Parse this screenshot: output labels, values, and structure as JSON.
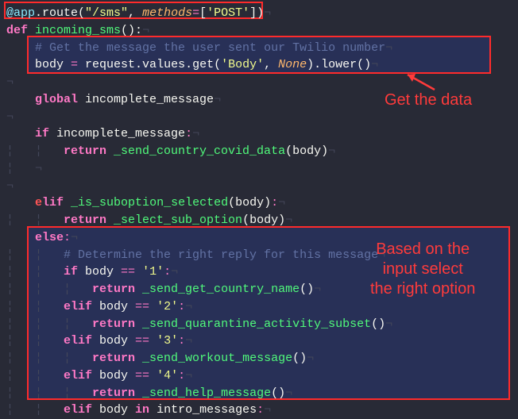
{
  "annotations": {
    "get_data": "Get the data",
    "select_option": "Based on the\ninput select\nthe right option"
  },
  "code": {
    "l1_decorator": "@app",
    "l1_route": ".route(",
    "l1_path": "\"/sms\"",
    "l1_comma": ", ",
    "l1_methods_kw": "methods",
    "l1_eq": "=",
    "l1_br_open": "[",
    "l1_methods_val": "'POST'",
    "l1_br_close": "])",
    "l2_def": "def ",
    "l2_fn": "incoming_sms",
    "l2_sig": "():",
    "l3_cmt": "# Get the message the user sent our Twilio number",
    "l4_body": "body ",
    "l4_eq": "=",
    "l4_req": " request.values.get(",
    "l4_key": "'Body'",
    "l4_c": ", ",
    "l4_none": "None",
    "l4_tail": ").lower()",
    "l6_global": "global ",
    "l6_var": "incomplete_message",
    "l8_if": "if ",
    "l8_var": "incomplete_message",
    "l8_colon": ":",
    "l9_return": "return ",
    "l9_fn": "_send_country_covid_data",
    "l9_arg": "(body)",
    "l12_e": "e",
    "l12_lif": "lif ",
    "l12_fn": "_is_suboption_selected",
    "l12_arg": "(body)",
    "l12_colon": ":",
    "l13_return": "return ",
    "l13_fn": "_select_sub_option",
    "l13_arg": "(body)",
    "l14_else": "else",
    "l14_colon": ":",
    "l15_cmt": "# Determine the right reply for this message",
    "l16_if": "if ",
    "l16_body": "body ",
    "l16_eq": "==",
    "l16_sp": " ",
    "l16_str": "'1'",
    "l16_colon": ":",
    "l17_return": "return ",
    "l17_fn": "_send_get_country_name",
    "l17_call": "()",
    "l18_elif": "elif ",
    "l18_body": "body ",
    "l18_eq": "==",
    "l18_sp": " ",
    "l18_str": "'2'",
    "l18_colon": ":",
    "l19_return": "return ",
    "l19_fn": "_send_quarantine_activity_subset",
    "l19_call": "()",
    "l20_elif": "elif ",
    "l20_body": "body ",
    "l20_eq": "==",
    "l20_sp": " ",
    "l20_str": "'3'",
    "l20_colon": ":",
    "l21_return": "return ",
    "l21_fn": "_send_workout_message",
    "l21_call": "()",
    "l22_elif": "elif ",
    "l22_body": "body ",
    "l22_eq": "==",
    "l22_sp": " ",
    "l22_str": "'4'",
    "l22_colon": ":",
    "l23_return": "return ",
    "l23_fn": "_send_help_message",
    "l23_call": "()",
    "l24_elif": "elif ",
    "l24_body": "body ",
    "l24_in": "in",
    "l24_sp": " ",
    "l24_var": "intro_messages",
    "l24_colon": ":"
  },
  "ws": {
    "pilcrow": "¬",
    "ind1": "    ",
    "ind1g": "¦   ",
    "ind2": "¦   ¦   ",
    "ind3": "¦   ¦   ¦   "
  }
}
